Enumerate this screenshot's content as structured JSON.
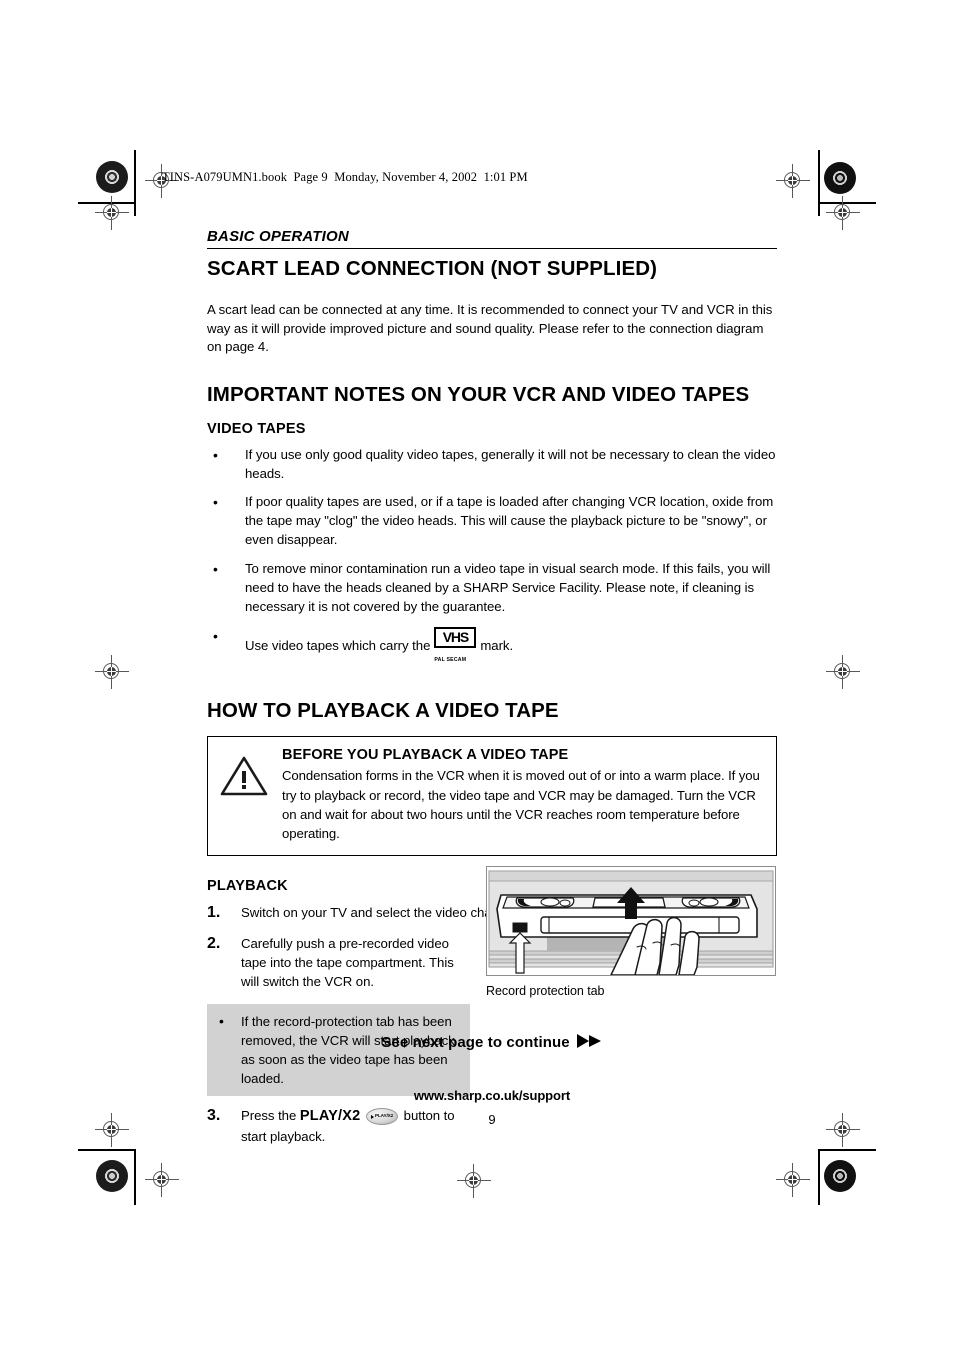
{
  "page": {
    "book_header": "TINS-A079UMN1.book  Page 9  Monday, November 4, 2002  1:01 PM",
    "kicker": "BASIC OPERATION",
    "page_number": "9",
    "footer_url": "www.sharp.co.uk/support",
    "see_next": "See next page to continue"
  },
  "scart": {
    "title": "SCART LEAD CONNECTION (NOT SUPPLIED)",
    "body": "A scart lead can be connected at any time. It is recommended to connect your TV and VCR in this way as it will provide improved picture and sound quality. Please refer to the connection diagram on page 4."
  },
  "important_notes": {
    "title": "IMPORTANT NOTES ON YOUR VCR AND VIDEO TAPES",
    "video_tapes_heading": "VIDEO TAPES",
    "bullets": [
      "If you use only good quality video tapes, generally it will not be necessary to clean the video heads.",
      "If poor quality tapes are used, or if a tape is loaded after changing VCR location, oxide from the tape may \"clog\" the video heads. This will cause the playback picture to be \"snowy\", or even disappear.",
      "To remove minor contamination run a video tape in visual search mode. If this fails, you will need to have the heads cleaned by a SHARP Service Facility. Please note, if cleaning is necessary it is not covered by the guarantee."
    ],
    "vhs_bullet_pre": "Use video tapes which carry the",
    "vhs_bullet_post": "mark.",
    "vhs_logo_text": "VHS",
    "vhs_logo_sub": "PAL   SECAM"
  },
  "playback_section": {
    "title": "HOW TO PLAYBACK A VIDEO TAPE",
    "warning": {
      "title": "BEFORE YOU PLAYBACK A VIDEO TAPE",
      "text": "Condensation forms in the VCR when it is moved out of or into a warm place. If you try to playback or record, the video tape and VCR may be damaged. Turn the VCR on and wait for about two hours until the VCR reaches room temperature before operating."
    },
    "playback_heading": "PLAYBACK",
    "steps": [
      {
        "num": "1.",
        "text": "Switch on your TV and select the video channel."
      },
      {
        "num": "2.",
        "text": "Carefully push a pre-recorded video tape into the tape compartment. This will switch the VCR on."
      }
    ],
    "grey_note": "If the record-protection tab has been removed, the VCR will start playback as soon as the video tape has been loaded.",
    "step3": {
      "num": "3.",
      "pre": "Press the",
      "button_label": "PLAY/X2",
      "button_glyph_text": "PLAY/X2",
      "post": "button to start playback."
    },
    "figure_caption": "Record protection tab"
  }
}
